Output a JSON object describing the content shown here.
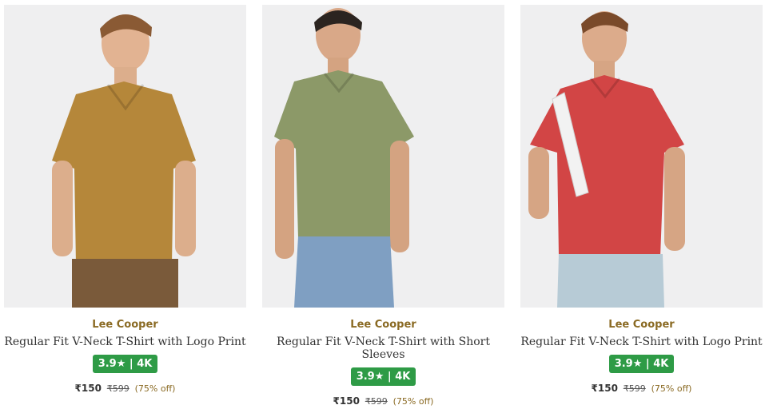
{
  "products": [
    {
      "brand": "Lee Cooper",
      "name": "Regular Fit V-Neck T-Shirt with Logo Print",
      "rating": "3.9",
      "star": "★",
      "sep": " | ",
      "reviews": "4K",
      "price": "₹150",
      "mrp": "₹599",
      "discount": "(75% off)",
      "shirt_color": "#b5873a",
      "pants_color": "#7a5a3a"
    },
    {
      "brand": "Lee Cooper",
      "name": "Regular Fit V-Neck T-Shirt with Short Sleeves",
      "rating": "3.9",
      "star": "★",
      "sep": " | ",
      "reviews": "4K",
      "price": "₹150",
      "mrp": "₹599",
      "discount": "(75% off)",
      "shirt_color": "#8c9968",
      "pants_color": "#7f9fc2"
    },
    {
      "brand": "Lee Cooper",
      "name": "Regular Fit V-Neck T-Shirt with Logo Print",
      "rating": "3.9",
      "star": "★",
      "sep": " | ",
      "reviews": "4K",
      "price": "₹150",
      "mrp": "₹599",
      "discount": "(75% off)",
      "shirt_color": "#d24545",
      "pants_color": "#b7cbd6"
    }
  ]
}
